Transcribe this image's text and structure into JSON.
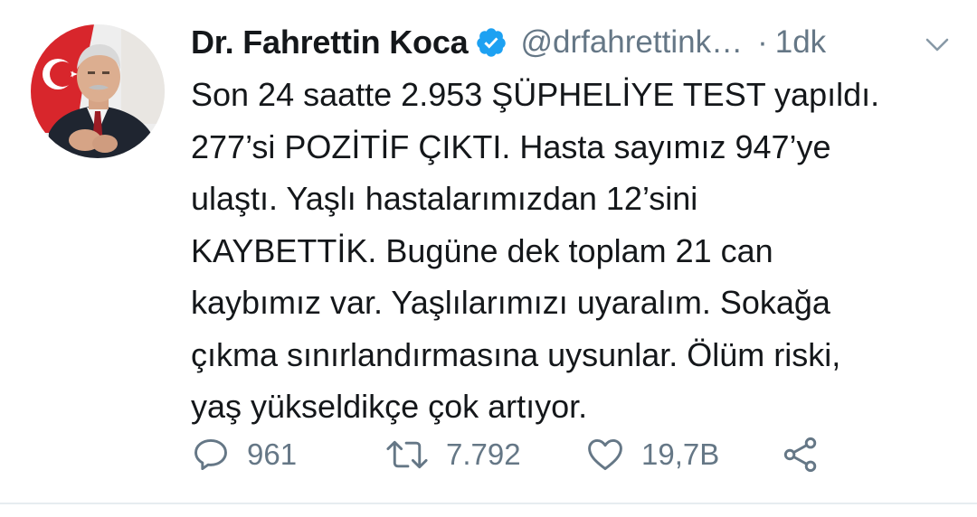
{
  "tweet": {
    "author": {
      "display_name": "Dr. Fahrettin Koca",
      "verified_icon": "verified-badge-icon",
      "handle": "@drfahrettink",
      "handle_ellipsis": "…",
      "avatar_icon": "profile-avatar"
    },
    "separator": "·",
    "time": "1dk",
    "menu_icon": "chevron-down-icon",
    "lines": [
      "Son 24 saatte 2.953 ŞÜPHELİYE TEST yapıldı.",
      "277’si POZİTİF ÇIKTI. Hasta sayımız 947’ye",
      "ulaştı. Yaşlı hastalarımızdan 12’sini",
      "KAYBETTİK. Bugüne dek toplam 21 can",
      "kaybımız var. Yaşlılarımızı uyaralım. Sokağa",
      "çıkma sınırlandırmasına uysunlar. Ölüm riski,",
      "yaş yükseldikçe çok artıyor."
    ],
    "actions": {
      "reply": {
        "icon": "reply-icon",
        "count": "961"
      },
      "retweet": {
        "icon": "retweet-icon",
        "count": "7.792"
      },
      "like": {
        "icon": "heart-icon",
        "count": "19,7B"
      },
      "share": {
        "icon": "share-icon"
      }
    }
  },
  "colors": {
    "text": "#14171a",
    "secondary": "#657786",
    "verified": "#1da1f2",
    "divider": "#e6ecf0"
  }
}
